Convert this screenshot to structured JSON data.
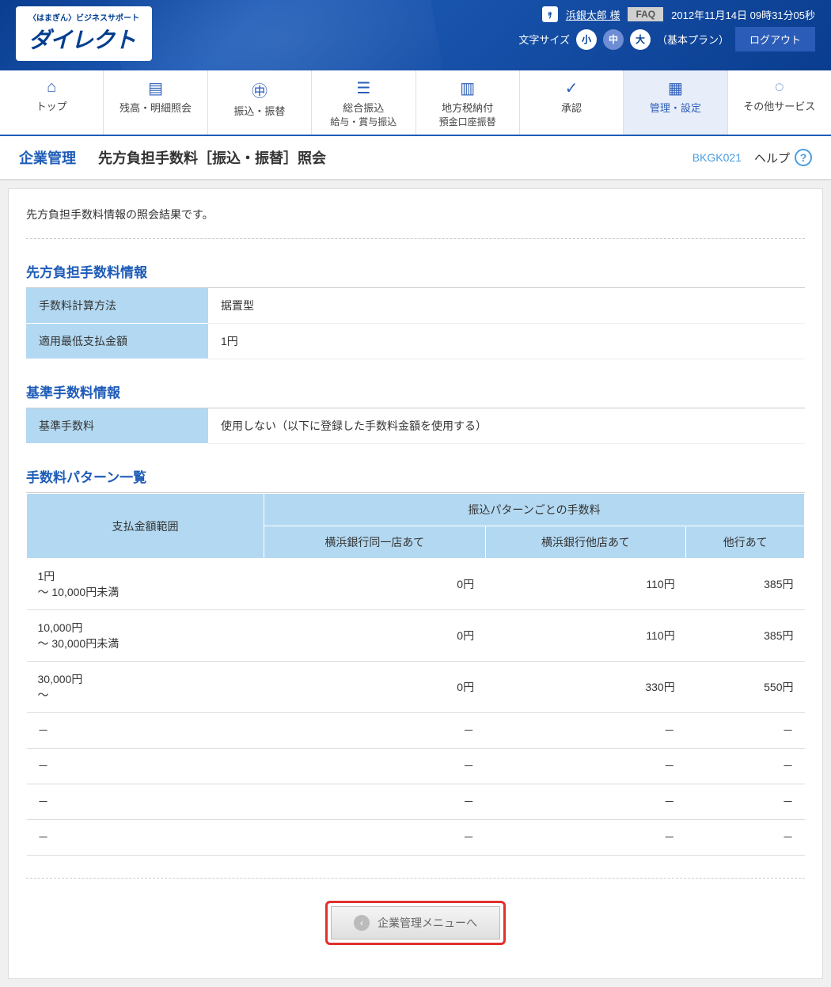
{
  "header": {
    "logo_small": "〈はまぎん〉ビジネスサポート",
    "logo_main": "ダイレクト",
    "user_name": "浜銀太郎 様",
    "faq": "FAQ",
    "datetime": "2012年11月14日 09時31分05秒",
    "size_label": "文字サイズ",
    "size_small": "小",
    "size_medium": "中",
    "size_large": "大",
    "plan": "（基本プラン）",
    "logout": "ログアウト"
  },
  "nav": [
    {
      "label": "トップ",
      "line2": ""
    },
    {
      "label": "残高・明細照会",
      "line2": ""
    },
    {
      "label": "振込・振替",
      "line2": ""
    },
    {
      "label": "総合振込",
      "line2": "給与・賞与振込"
    },
    {
      "label": "地方税納付",
      "line2": "預金口座振替"
    },
    {
      "label": "承認",
      "line2": ""
    },
    {
      "label": "管理・設定",
      "line2": ""
    },
    {
      "label": "その他サービス",
      "line2": ""
    }
  ],
  "subhead": {
    "category": "企業管理",
    "title": "先方負担手数料［振込・振替］照会",
    "code": "BKGK021",
    "help": "ヘルプ"
  },
  "desc": "先方負担手数料情報の照会結果です。",
  "section1": {
    "title": "先方負担手数料情報",
    "rows": [
      {
        "label": "手数料計算方法",
        "value": "据置型"
      },
      {
        "label": "適用最低支払金額",
        "value": "1円"
      }
    ]
  },
  "section2": {
    "title": "基準手数料情報",
    "rows": [
      {
        "label": "基準手数料",
        "value": "使用しない（以下に登録した手数料金額を使用する）"
      }
    ]
  },
  "section3": {
    "title": "手数料パターン一覧",
    "col_range": "支払金額範囲",
    "col_group": "振込パターンごとの手数料",
    "cols": [
      "横浜銀行同一店あて",
      "横浜銀行他店あて",
      "他行あて"
    ],
    "rows": [
      {
        "range": "1円\n～ 10,000円未満",
        "v": [
          "0円",
          "110円",
          "385円"
        ]
      },
      {
        "range": "10,000円\n～ 30,000円未満",
        "v": [
          "0円",
          "110円",
          "385円"
        ]
      },
      {
        "range": "30,000円\n～",
        "v": [
          "0円",
          "330円",
          "550円"
        ]
      },
      {
        "range": "－",
        "v": [
          "－",
          "－",
          "－"
        ]
      },
      {
        "range": "－",
        "v": [
          "－",
          "－",
          "－"
        ]
      },
      {
        "range": "－",
        "v": [
          "－",
          "－",
          "－"
        ]
      },
      {
        "range": "－",
        "v": [
          "－",
          "－",
          "－"
        ]
      }
    ]
  },
  "action": {
    "menu_btn": "企業管理メニューへ"
  }
}
